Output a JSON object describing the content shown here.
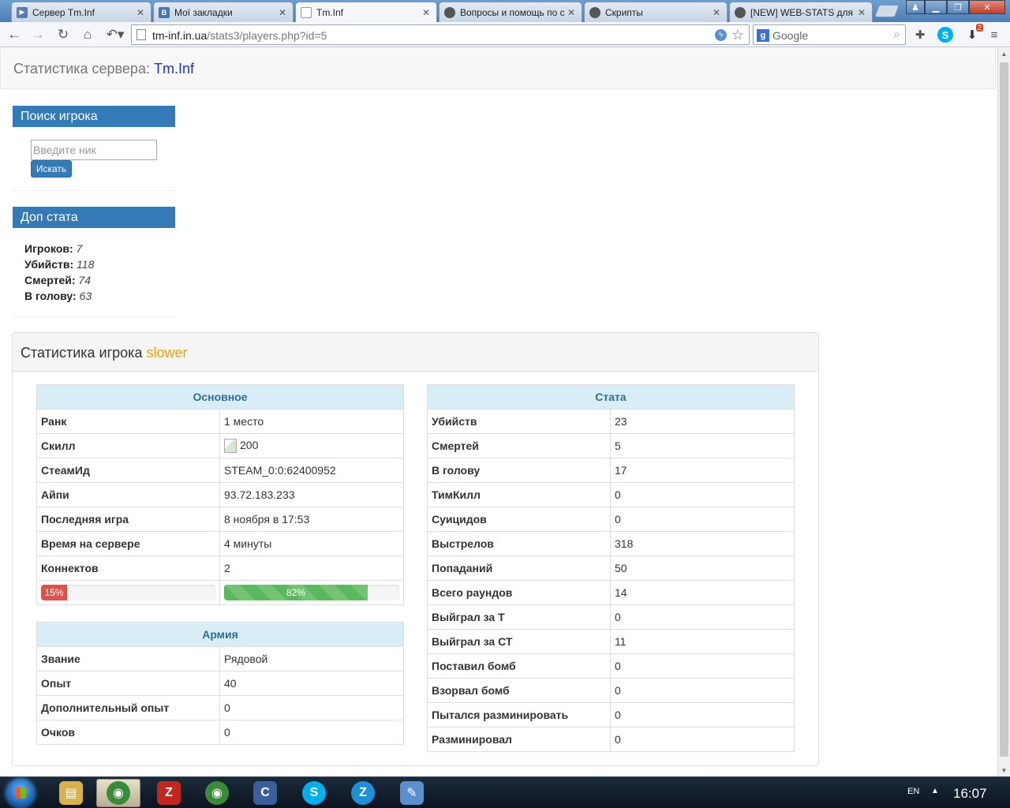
{
  "browser": {
    "tabs": [
      {
        "title": "Сервер Tm.Inf",
        "favicon": "play-icon",
        "color": "#5b7bb0"
      },
      {
        "title": "Мої закладки",
        "favicon": "vk-icon",
        "color": "#4a76a8"
      },
      {
        "title": "Tm.Inf",
        "favicon": "page-icon",
        "color": "#ffffff"
      },
      {
        "title": "Вопросы и помощь по скр",
        "favicon": "forum-avatar-icon",
        "color": "#555555"
      },
      {
        "title": "Скрипты",
        "favicon": "forum-avatar-icon",
        "color": "#555555"
      },
      {
        "title": "[NEW] WEB-STATS для csb",
        "favicon": "forum-avatar-icon",
        "color": "#555555"
      }
    ],
    "url_host": "tm-inf.in.ua",
    "url_path": "/stats3/players.php?id=5",
    "search_engine": "Google",
    "downloads_badge": "2"
  },
  "site": {
    "brand_prefix": "Статистика сервера:",
    "brand_name": "Tm.Inf"
  },
  "sidebar": {
    "search_title": "Поиск игрока",
    "search_placeholder": "Введите ник",
    "search_button": "Искать",
    "extra_title": "Доп стата",
    "extra": [
      {
        "label": "Игроков:",
        "value": "7"
      },
      {
        "label": "Убийств:",
        "value": "118"
      },
      {
        "label": "Смертей:",
        "value": "74"
      },
      {
        "label": "В голову:",
        "value": "63"
      }
    ]
  },
  "player": {
    "title_prefix": "Статистика игрока",
    "nick": "slower",
    "basic": {
      "header": "Основное",
      "rows": [
        {
          "k": "Ранк",
          "v": "1 место"
        },
        {
          "k": "Скилл",
          "v": "200"
        },
        {
          "k": "СтеамИд",
          "v": "STEAM_0:0:62400952"
        },
        {
          "k": "Айпи",
          "v": "93.72.183.233"
        },
        {
          "k": "Последняя игра",
          "v": "8 ноября в 17:53"
        },
        {
          "k": "Время на сервере",
          "v": "4 минуты"
        },
        {
          "k": "Коннектов",
          "v": "2"
        }
      ],
      "progress_left": {
        "label": "15%",
        "value": 15
      },
      "progress_right": {
        "label": "82%",
        "value": 82
      }
    },
    "army": {
      "header": "Армия",
      "rows": [
        {
          "k": "Звание",
          "v": "Рядовой"
        },
        {
          "k": "Опыт",
          "v": "40"
        },
        {
          "k": "Дополнительный опыт",
          "v": "0"
        },
        {
          "k": "Очков",
          "v": "0"
        }
      ]
    },
    "stats": {
      "header": "Стата",
      "rows": [
        {
          "k": "Убийств",
          "v": "23"
        },
        {
          "k": "Смертей",
          "v": "5"
        },
        {
          "k": "В голову",
          "v": "17"
        },
        {
          "k": "ТимКилл",
          "v": "0"
        },
        {
          "k": "Суицидов",
          "v": "0"
        },
        {
          "k": "Выстрелов",
          "v": "318"
        },
        {
          "k": "Попаданий",
          "v": "50"
        },
        {
          "k": "Всего раундов",
          "v": "14"
        },
        {
          "k": "Выйграл за Т",
          "v": "0"
        },
        {
          "k": "Выйграл за СТ",
          "v": "11"
        },
        {
          "k": "Поставил бомб",
          "v": "0"
        },
        {
          "k": "Взорвал бомб",
          "v": "0"
        },
        {
          "k": "Пытался разминировать",
          "v": "0"
        },
        {
          "k": "Разминировал",
          "v": "0"
        }
      ]
    }
  },
  "taskbar": {
    "apps": [
      {
        "name": "explorer-icon",
        "color": "#d9b24c"
      },
      {
        "name": "chrome-icon",
        "color": "#3b8a3b"
      },
      {
        "name": "filezilla-icon",
        "color": "#c0271f"
      },
      {
        "name": "chrome-icon",
        "color": "#3b8a3b"
      },
      {
        "name": "ccleaner-icon",
        "color": "#3a5f9a"
      },
      {
        "name": "skype-icon",
        "color": "#00aff0"
      },
      {
        "name": "zona-icon",
        "color": "#1e90d8"
      },
      {
        "name": "paint-icon",
        "color": "#5c8fd0"
      }
    ],
    "lang": "EN",
    "clock": "16:07"
  }
}
